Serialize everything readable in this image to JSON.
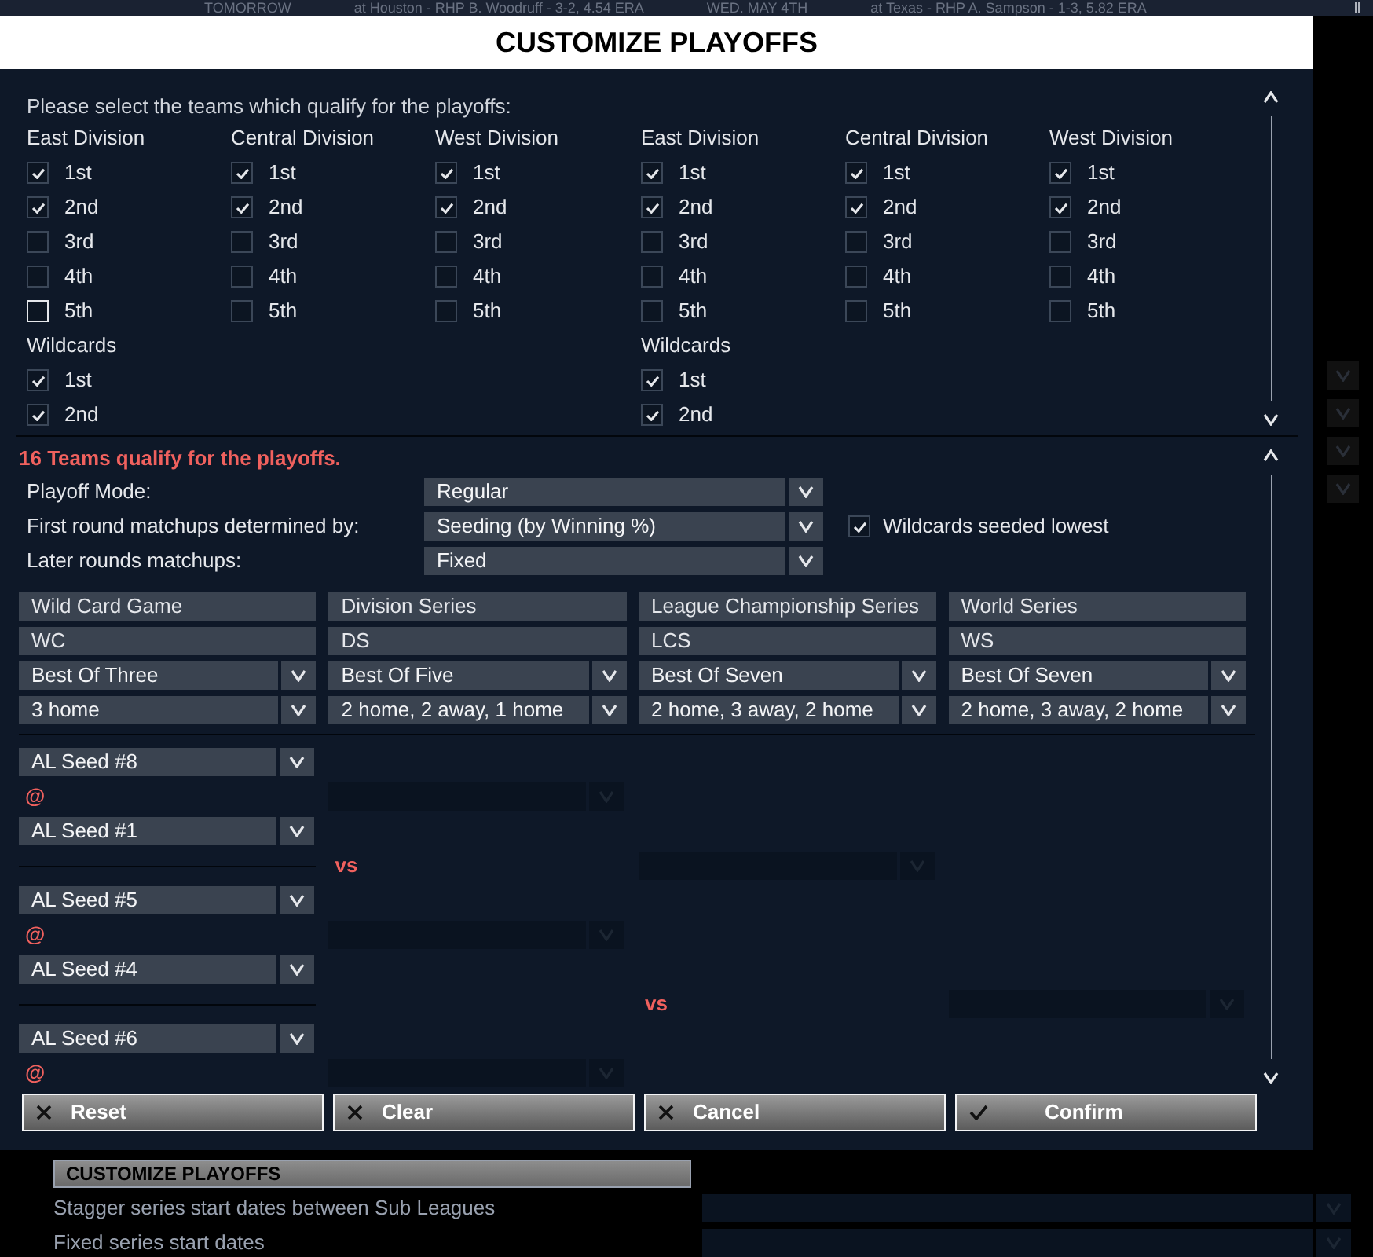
{
  "background_bar": {
    "items": [
      "TOMORROW",
      "at Houston - RHP B. Woodruff - 3-2, 4.54 ERA",
      "WED. MAY 4TH",
      "at Texas - RHP A. Sampson - 1-3, 5.82 ERA"
    ],
    "corner": "ll"
  },
  "dialog": {
    "title": "CUSTOMIZE PLAYOFFS",
    "prompt": "Please select the teams which qualify for the playoffs:",
    "leagues": [
      {
        "divisions": [
          {
            "name": "East Division",
            "places": [
              {
                "label": "1st",
                "checked": true
              },
              {
                "label": "2nd",
                "checked": true
              },
              {
                "label": "3rd",
                "checked": false
              },
              {
                "label": "4th",
                "checked": false
              },
              {
                "label": "5th",
                "checked": false
              }
            ]
          },
          {
            "name": "Central Division",
            "places": [
              {
                "label": "1st",
                "checked": true
              },
              {
                "label": "2nd",
                "checked": true
              },
              {
                "label": "3rd",
                "checked": false
              },
              {
                "label": "4th",
                "checked": false
              },
              {
                "label": "5th",
                "checked": false
              }
            ]
          },
          {
            "name": "West Division",
            "places": [
              {
                "label": "1st",
                "checked": true
              },
              {
                "label": "2nd",
                "checked": true
              },
              {
                "label": "3rd",
                "checked": false
              },
              {
                "label": "4th",
                "checked": false
              },
              {
                "label": "5th",
                "checked": false
              }
            ]
          }
        ],
        "wildcards": {
          "name": "Wildcards",
          "places": [
            {
              "label": "1st",
              "checked": true
            },
            {
              "label": "2nd",
              "checked": true
            }
          ]
        }
      },
      {
        "divisions": [
          {
            "name": "East Division",
            "places": [
              {
                "label": "1st",
                "checked": true
              },
              {
                "label": "2nd",
                "checked": true
              },
              {
                "label": "3rd",
                "checked": false
              },
              {
                "label": "4th",
                "checked": false
              },
              {
                "label": "5th",
                "checked": false
              }
            ]
          },
          {
            "name": "Central Division",
            "places": [
              {
                "label": "1st",
                "checked": true
              },
              {
                "label": "2nd",
                "checked": true
              },
              {
                "label": "3rd",
                "checked": false
              },
              {
                "label": "4th",
                "checked": false
              },
              {
                "label": "5th",
                "checked": false
              }
            ]
          },
          {
            "name": "West Division",
            "places": [
              {
                "label": "1st",
                "checked": true
              },
              {
                "label": "2nd",
                "checked": true
              },
              {
                "label": "3rd",
                "checked": false
              },
              {
                "label": "4th",
                "checked": false
              },
              {
                "label": "5th",
                "checked": false
              }
            ]
          }
        ],
        "wildcards": {
          "name": "Wildcards",
          "places": [
            {
              "label": "1st",
              "checked": true
            },
            {
              "label": "2nd",
              "checked": true
            }
          ]
        }
      }
    ],
    "qualify_note": "16 Teams qualify for the playoffs.",
    "settings": [
      {
        "label": "Playoff Mode:",
        "value": "Regular"
      },
      {
        "label": "First round matchups determined by:",
        "value": "Seeding (by Winning %)",
        "option": {
          "label": "Wildcards seeded lowest",
          "checked": true
        }
      },
      {
        "label": "Later rounds matchups:",
        "value": "Fixed"
      }
    ],
    "rounds": [
      {
        "name": "Wild Card Game",
        "abbr": "WC",
        "length": "Best Of Three",
        "format": "3 home"
      },
      {
        "name": "Division Series",
        "abbr": "DS",
        "length": "Best Of Five",
        "format": "2 home, 2 away, 1 home"
      },
      {
        "name": "League Championship Series",
        "abbr": "LCS",
        "length": "Best Of Seven",
        "format": "2 home, 3 away, 2 home"
      },
      {
        "name": "World Series",
        "abbr": "WS",
        "length": "Best Of Seven",
        "format": "2 home, 3 away, 2 home"
      }
    ],
    "bracket": [
      [
        {
          "kind": "dropdown",
          "text": "AL Seed #8"
        },
        {
          "kind": "blank"
        },
        {
          "kind": "blank"
        },
        {
          "kind": "blank"
        }
      ],
      [
        {
          "kind": "mark",
          "text": "@"
        },
        {
          "kind": "empty"
        },
        {
          "kind": "blank"
        },
        {
          "kind": "blank"
        }
      ],
      [
        {
          "kind": "dropdown",
          "text": "AL Seed #1"
        },
        {
          "kind": "blank"
        },
        {
          "kind": "blank"
        },
        {
          "kind": "blank"
        }
      ],
      [
        {
          "kind": "divider"
        },
        {
          "kind": "mark",
          "text": "vs"
        },
        {
          "kind": "empty"
        },
        {
          "kind": "blank"
        }
      ],
      [
        {
          "kind": "dropdown",
          "text": "AL Seed #5"
        },
        {
          "kind": "blank"
        },
        {
          "kind": "blank"
        },
        {
          "kind": "blank"
        }
      ],
      [
        {
          "kind": "mark",
          "text": "@"
        },
        {
          "kind": "empty"
        },
        {
          "kind": "blank"
        },
        {
          "kind": "blank"
        }
      ],
      [
        {
          "kind": "dropdown",
          "text": "AL Seed #4"
        },
        {
          "kind": "blank"
        },
        {
          "kind": "blank"
        },
        {
          "kind": "blank"
        }
      ],
      [
        {
          "kind": "divider"
        },
        {
          "kind": "blank"
        },
        {
          "kind": "mark",
          "text": "vs"
        },
        {
          "kind": "empty"
        }
      ],
      [
        {
          "kind": "dropdown",
          "text": "AL Seed #6"
        },
        {
          "kind": "blank"
        },
        {
          "kind": "blank"
        },
        {
          "kind": "blank"
        }
      ],
      [
        {
          "kind": "mark",
          "text": "@"
        },
        {
          "kind": "empty"
        },
        {
          "kind": "blank"
        },
        {
          "kind": "blank"
        }
      ]
    ],
    "buttons": [
      {
        "label": "Reset",
        "kind": "cancel"
      },
      {
        "label": "Clear",
        "kind": "cancel"
      },
      {
        "label": "Cancel",
        "kind": "cancel"
      },
      {
        "label": "Confirm",
        "kind": "confirm"
      }
    ]
  },
  "behind": {
    "section": "CUSTOMIZE PLAYOFFS",
    "rows": [
      "Stagger series start dates between Sub Leagues",
      "Fixed series start dates"
    ]
  }
}
